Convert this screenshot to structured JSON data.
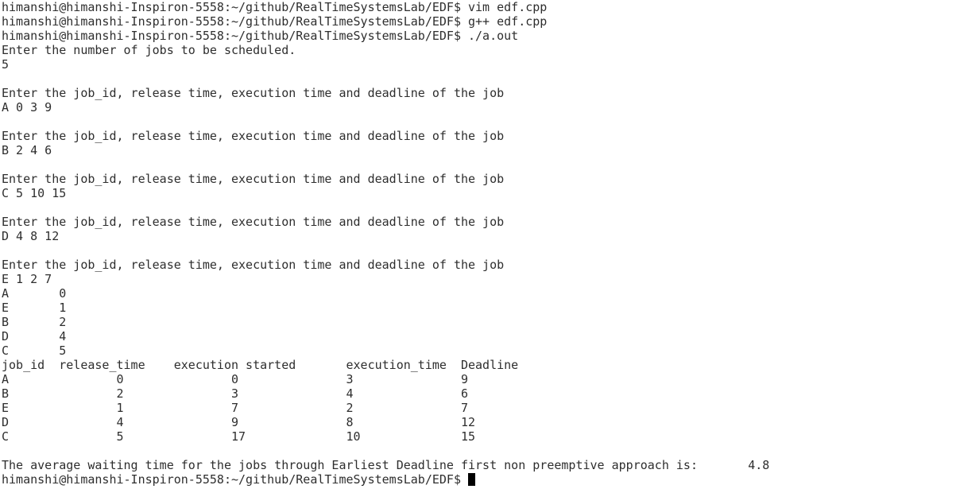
{
  "terminal": {
    "lines": [
      "himanshi@himanshi-Inspiron-5558:~/github/RealTimeSystemsLab/EDF$ vim edf.cpp",
      "himanshi@himanshi-Inspiron-5558:~/github/RealTimeSystemsLab/EDF$ g++ edf.cpp",
      "himanshi@himanshi-Inspiron-5558:~/github/RealTimeSystemsLab/EDF$ ./a.out",
      "Enter the number of jobs to be scheduled.",
      "5",
      "",
      "Enter the job_id, release time, execution time and deadline of the job",
      "A 0 3 9",
      "",
      "Enter the job_id, release time, execution time and deadline of the job",
      "B 2 4 6",
      "",
      "Enter the job_id, release time, execution time and deadline of the job",
      "C 5 10 15",
      "",
      "Enter the job_id, release time, execution time and deadline of the job",
      "D 4 8 12",
      "",
      "Enter the job_id, release time, execution time and deadline of the job",
      "E 1 2 7",
      "A       0",
      "E       1",
      "B       2",
      "D       4",
      "C       5",
      "job_id  release_time    execution started       execution_time  Deadline",
      "A               0               0               3               9",
      "B               2               3               4               6",
      "E               1               7               2               7",
      "D               4               9               8               12",
      "C               5               17              10              15",
      "",
      "The average waiting time for the jobs through Earliest Deadline first non preemptive approach is:       4.8"
    ],
    "prompt": "himanshi@himanshi-Inspiron-5558:~/github/RealTimeSystemsLab/EDF$ "
  }
}
